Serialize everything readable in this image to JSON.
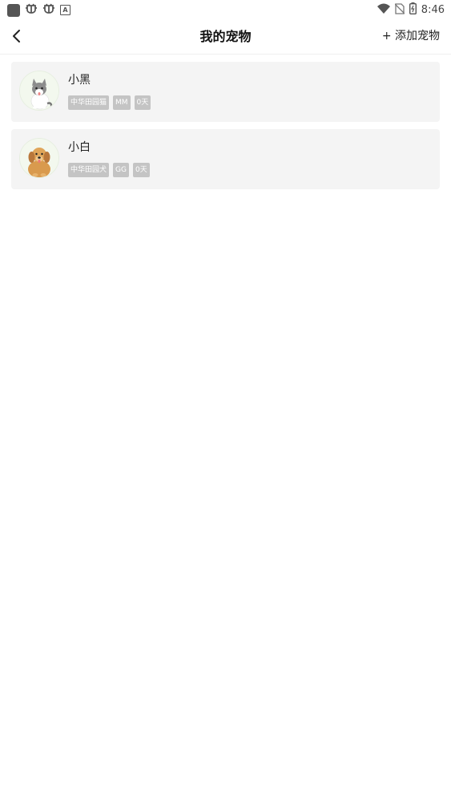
{
  "status_bar": {
    "time": "8:46",
    "left_icons": [
      "app-square-icon",
      "bug-icon",
      "bug-icon",
      "a-badge-icon"
    ],
    "right_icons": [
      "wifi-icon",
      "no-sim-icon",
      "battery-icon"
    ]
  },
  "header": {
    "title": "我的宠物",
    "add_button_label": "+ 添加宠物"
  },
  "pets": [
    {
      "name": "小黑",
      "avatar": "cat-avatar",
      "tags": [
        "中华田园猫",
        "MM",
        "0天"
      ]
    },
    {
      "name": "小白",
      "avatar": "dog-avatar",
      "tags": [
        "中华田园犬",
        "GG",
        "0天"
      ]
    }
  ],
  "colors": {
    "card_background": "#f4f4f4",
    "tag_background": "#c4c4c4",
    "tag_text": "#ffffff"
  }
}
